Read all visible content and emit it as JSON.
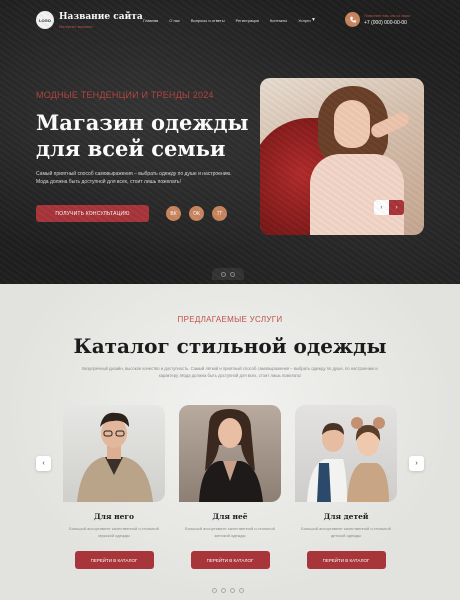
{
  "header": {
    "logo_text": "LOGO",
    "site_title": "Название сайта",
    "site_subtitle": "Интернет-магазин",
    "nav": [
      "Главная",
      "О нас",
      "Вопросы и ответы",
      "Регистрация",
      "Контакты",
      "Услуги"
    ],
    "nav_extra": "▾",
    "phone_caption": "Позвоните нам, мы на связи",
    "phone_number": "+7 (000) 000-00-00"
  },
  "hero": {
    "kicker": "МОДНЫЕ ТЕНДЕНЦИИ И ТРЕНДЫ 2024",
    "title": "Магазин одежды для всей семьи",
    "text": "Самый приятный способ самовыражения – выбрать одежду по душе и настроению. Мода должна быть доступной для всех, стоит лишь пожелать!",
    "cta_label": "ПОЛУЧИТЬ КОНСУЛЬТАЦИЮ",
    "social": [
      "ВК",
      "ОК",
      "ТГ"
    ],
    "prev": "‹",
    "next": "›"
  },
  "catalog": {
    "kicker": "ПРЕДЛАГАЕМЫЕ УСЛУГИ",
    "title": "Каталог стильной одежды",
    "text": "Безупречный дизайн, высокое качество и доступность. Самый лёгкий и приятный способ самовыражения – выбрать одежду по душе, по настроению и характеру. Мода должна быть доступной для всех, стоит лишь пожелать!",
    "prev": "‹",
    "next": "›",
    "cards": [
      {
        "title": "Для него",
        "desc": "Большой ассортимент качественной и стильной мужской одежды",
        "button": "ПЕРЕЙТИ В КАТАЛОГ"
      },
      {
        "title": "Для неё",
        "desc": "Большой ассортимент качественной и стильной женской одежды",
        "button": "ПЕРЕЙТИ В КАТАЛОГ"
      },
      {
        "title": "Для детей",
        "desc": "Большой ассортимент качественной и стильной детской одежды",
        "button": "ПЕРЕЙТИ В КАТАЛОГ"
      }
    ]
  },
  "colors": {
    "accent": "#a8353a",
    "accent_light": "#c9855f",
    "dark": "#1f1f1f"
  }
}
